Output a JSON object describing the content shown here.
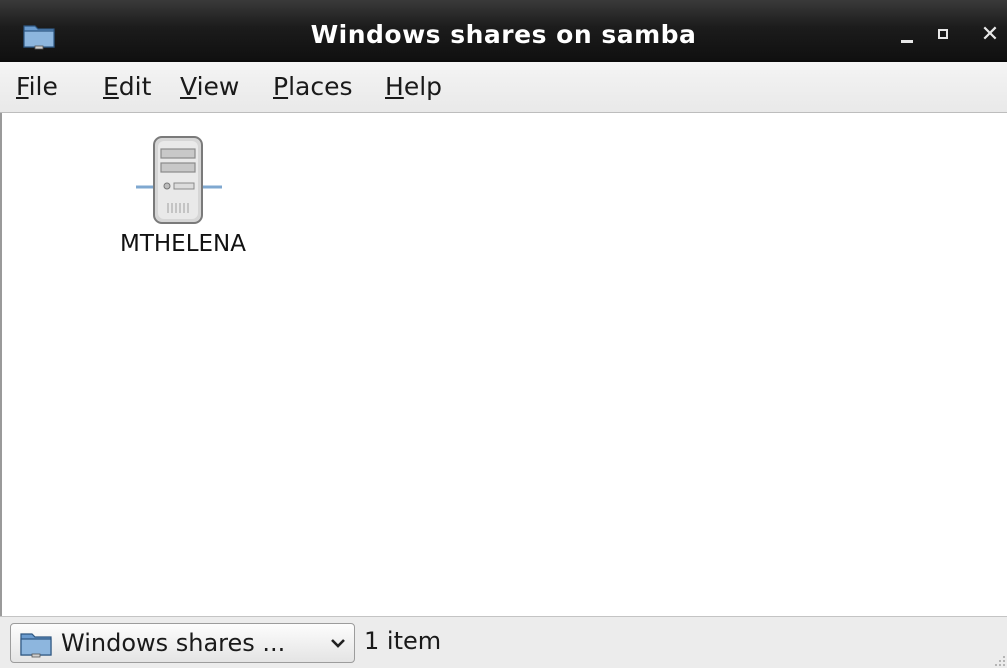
{
  "window": {
    "title": "Windows shares on samba",
    "app_icon": "folder-network-icon",
    "controls": {
      "minimize_icon": "minimize-icon",
      "maximize_icon": "maximize-icon",
      "close_icon": "close-icon",
      "close_glyph": "✕"
    }
  },
  "menubar": {
    "items": [
      {
        "label_first": "F",
        "label_rest": "ile"
      },
      {
        "label_first": "E",
        "label_rest": "dit"
      },
      {
        "label_first": "V",
        "label_rest": "iew"
      },
      {
        "label_first": "P",
        "label_rest": "laces"
      },
      {
        "label_first": "H",
        "label_rest": "elp"
      }
    ]
  },
  "content": {
    "items": [
      {
        "label": "MTHELENA",
        "icon": "server-icon"
      }
    ]
  },
  "statusbar": {
    "location_label": "Windows shares ...",
    "location_icon": "folder-network-icon",
    "status_text": "1 item"
  },
  "colors": {
    "titlebar_bg": "#1c1c1c",
    "folder_blue": "#4a7fb5"
  }
}
